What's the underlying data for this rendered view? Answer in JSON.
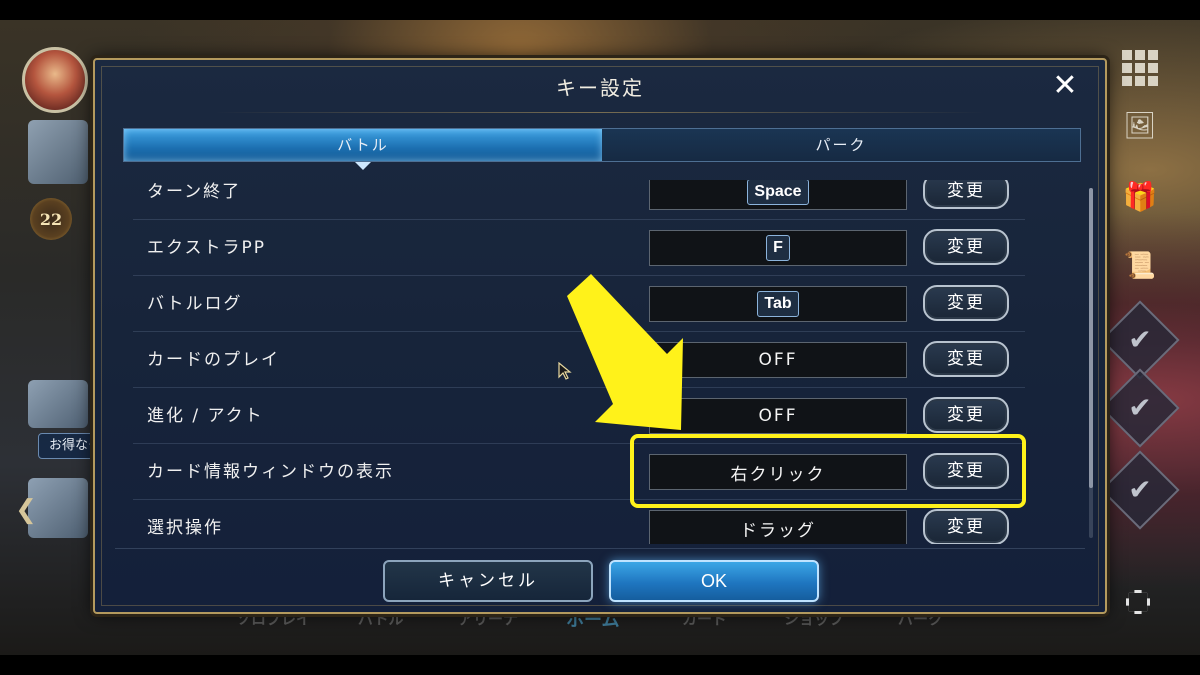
{
  "dialog": {
    "title": "キー設定",
    "close_symbol": "✕",
    "tabs": [
      {
        "label": "バトル",
        "active": true
      },
      {
        "label": "パーク",
        "active": false
      }
    ],
    "rows": [
      {
        "label": "ターン終了",
        "key": "Space",
        "key_style": "keycap",
        "button": "変更"
      },
      {
        "label": "エクストラPP",
        "key": "F",
        "key_style": "keycap",
        "button": "変更"
      },
      {
        "label": "バトルログ",
        "key": "Tab",
        "key_style": "keycap",
        "button": "変更"
      },
      {
        "label": "カードのプレイ",
        "key": "OFF",
        "key_style": "text",
        "button": "変更"
      },
      {
        "label": "進化 / アクト",
        "key": "OFF",
        "key_style": "text",
        "button": "変更"
      },
      {
        "label": "カード情報ウィンドウの表示",
        "key": "右クリック",
        "key_style": "text",
        "button": "変更",
        "highlighted": true
      },
      {
        "label": "選択操作",
        "key": "ドラッグ",
        "key_style": "text",
        "button": "変更"
      }
    ],
    "cancel_label": "キャンセル",
    "ok_label": "OK"
  },
  "background": {
    "level": "22",
    "promo_label": "お得なクリ",
    "nav_items": [
      "ソロプレイ",
      "バトル",
      "アリーナ",
      "ホーム",
      "カード",
      "ショップ",
      "パーク"
    ],
    "active_nav": "ホーム"
  },
  "annotation": {
    "arrow_color": "#fff21a",
    "highlight_color": "#fff21a"
  },
  "colors": {
    "accent_blue": "#1f76c0",
    "frame_gold": "#b49a5e",
    "dialog_bg": "#17243a"
  }
}
